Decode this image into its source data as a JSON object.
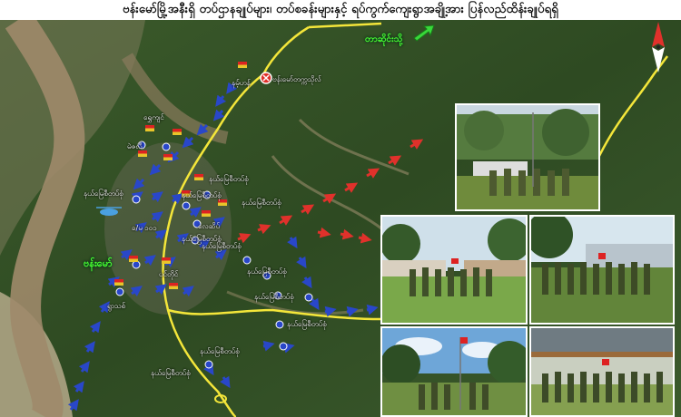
{
  "title": "ဗန်းမော်မြို့အနီးရှိ တပ်ဌာနချုပ်များ၊ တပ်စခန်းများနှင့် ရပ်ကွက်ကျေးရွာအချို့အား ပြန်လည်ထိန်းချုပ်ရရှိ",
  "map": {
    "road_label": "တာဆိုင်းသို့",
    "town_label": "ဗန်းမော်",
    "hq_label": "ခ/မ ၁၀၁",
    "airport_label": "လေဆိပ်",
    "base_label": "နယ်မြေစီတပ်စုံ",
    "station_labels": [
      "နယ်မြေစီတပ်စုံ",
      "နယ်မြေစီတပ်စုံ",
      "နယ်မြေစီတပ်စုံ",
      "နယ်မြေစီတပ်စုံ",
      "နယ်မြေစီတပ်စုံ",
      "နယ်မြေစီတပ်စုံ",
      "နယ်မြေစီတပ်စုံ",
      "နယ်မြေစီတပ်စုံ",
      "နယ်မြေစီတပ်စုံ",
      "နယ်မြေစီတပ်စုံ",
      "နယ်မြေစီတပ်စုံ"
    ],
    "point_labels": [
      "နမ့်ဟန်",
      "ဗန်းမော်တက္ကသိုလ်",
      "ရွှေကျင်",
      "မဲဇလီ",
      "ပင်တိုင်",
      "ရွာသစ်"
    ],
    "colors": {
      "road": "#f4e63a",
      "advance_arrow": "#e0312b",
      "friendly_arrow": "#2947c9",
      "river": "#9e8a6a"
    }
  },
  "compass": {
    "icon": "north-arrow-icon"
  },
  "photos": [
    {
      "icon": "troops-photo-1"
    },
    {
      "icon": "troops-photo-2"
    },
    {
      "icon": "troops-photo-3"
    },
    {
      "icon": "troops-photo-4"
    },
    {
      "icon": "troops-photo-5"
    }
  ]
}
